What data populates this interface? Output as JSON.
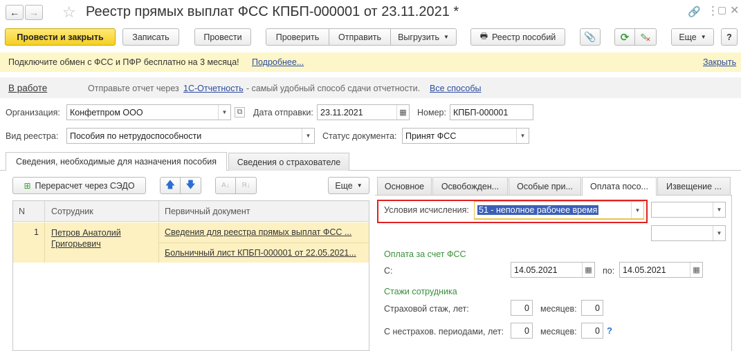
{
  "window": {
    "title": "Реестр прямых выплат ФСС КПБП-000001 от 23.11.2021 *"
  },
  "toolbar": {
    "post_close": "Провести и закрыть",
    "save": "Записать",
    "post": "Провести",
    "check": "Проверить",
    "send": "Отправить",
    "export": "Выгрузить",
    "registry_benefits": "Реестр пособий",
    "more": "Еще",
    "help": "?"
  },
  "banner": {
    "text": "Подключите обмен с ФСС и ПФР бесплатно на 3 месяца!",
    "more_link": "Подробнее...",
    "close_link": "Закрыть"
  },
  "status_bar": {
    "status_link": "В работе",
    "text_before": "Отправьте отчет через",
    "service_link": "1С-Отчетность",
    "text_after": "- самый удобный способ сдачи отчетности.",
    "all_ways_link": "Все способы"
  },
  "form": {
    "org_label": "Организация:",
    "org_value": "Конфетпром ООО",
    "send_date_label": "Дата отправки:",
    "send_date_value": "23.11.2021",
    "number_label": "Номер:",
    "number_value": "КПБП-000001",
    "registry_type_label": "Вид реестра:",
    "registry_type_value": "Пособия по нетрудоспособности",
    "doc_status_label": "Статус документа:",
    "doc_status_value": "Принят ФСС"
  },
  "main_tabs": [
    {
      "label": "Сведения, необходимые для назначения пособия",
      "active": true
    },
    {
      "label": "Сведения о страхователе",
      "active": false
    }
  ],
  "left_panel": {
    "recalc_button": "Перерасчет через СЭДО",
    "more_button": "Еще",
    "columns": [
      "N",
      "Сотрудник",
      "Первичный документ"
    ],
    "rows": [
      {
        "n": "1",
        "employee": "Петров Анатолий Григорьевич",
        "doc1": "Сведения для реестра прямых выплат ФСС ...",
        "doc2": "Больничный лист КПБП-000001 от 22.05.2021..."
      }
    ]
  },
  "right_panel": {
    "tabs": [
      {
        "label": "Основное",
        "active": false
      },
      {
        "label": "Освобожден...",
        "active": false
      },
      {
        "label": "Особые при...",
        "active": false
      },
      {
        "label": "Оплата посо...",
        "active": true
      },
      {
        "label": "Извещение ...",
        "active": false
      }
    ],
    "calc_conditions_label": "Условия исчисления:",
    "calc_conditions_value": "51 - неполное рабочее время",
    "fss_section": "Оплата за счет ФСС",
    "from_label": "С:",
    "from_value": "14.05.2021",
    "to_label": "по:",
    "to_value": "14.05.2021",
    "experience_section": "Стажи сотрудника",
    "insurance_exp_label": "Страховой стаж, лет:",
    "insurance_years": "0",
    "months_label": "месяцев:",
    "insurance_months": "0",
    "noninsured_label": "С нестрахов. периодами, лет:",
    "noninsured_years": "0",
    "noninsured_months": "0",
    "help_mark": "?"
  },
  "colors": {
    "accent_yellow": "#f5cf22",
    "banner_bg": "#fdf6c8",
    "highlight_red": "#e02020",
    "selected_row": "#fdf1c2",
    "green_section": "#3a8f3a"
  }
}
